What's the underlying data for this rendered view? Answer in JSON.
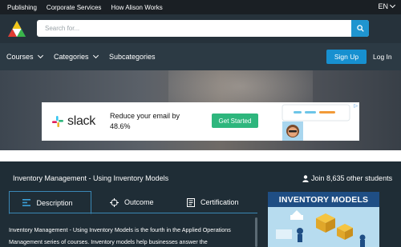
{
  "topbar": {
    "links": [
      "Publishing",
      "Corporate Services",
      "How Alison Works"
    ],
    "language": "EN"
  },
  "header": {
    "search_placeholder": "Search for..."
  },
  "nav": {
    "courses": "Courses",
    "categories": "Categories",
    "subcategories": "Subcategories",
    "signup": "Sign Up",
    "login": "Log In"
  },
  "ad": {
    "brand": "slack",
    "text": "Reduce your email by 48.6%",
    "cta": "Get Started"
  },
  "course": {
    "title": "Inventory Management - Using Inventory Models",
    "join": "Join 8,635 other students",
    "tabs": [
      "Description",
      "Outcome",
      "Certification"
    ],
    "description": "Inventory Management - Using Inventory Models is the fourth in the Applied Operations Management series of courses. Inventory models help businesses answer the",
    "thumbnail_title": "INVENTORY MODELS"
  },
  "colors": {
    "accent": "#1790d0",
    "ad_cta": "#2eb67d",
    "tab_border": "#3a87b5"
  }
}
